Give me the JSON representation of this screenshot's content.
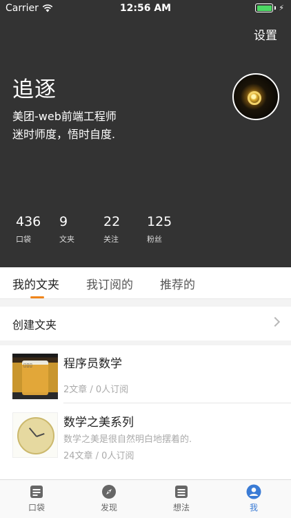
{
  "status_bar": {
    "carrier": "Carrier",
    "time": "12:56 AM",
    "battery_color": "#4cd964"
  },
  "header": {
    "settings_label": "设置",
    "name": "追逐",
    "job": "美团-web前端工程师",
    "motto": "迷时师度，悟时自度.",
    "background_color": "#333333"
  },
  "stats": [
    {
      "value": "436",
      "label": "口袋"
    },
    {
      "value": "9",
      "label": "文夹"
    },
    {
      "value": "22",
      "label": "关注"
    },
    {
      "value": "125",
      "label": "粉丝"
    }
  ],
  "tabs": [
    {
      "label": "我的文夹",
      "active": true
    },
    {
      "label": "我订阅的",
      "active": false
    },
    {
      "label": "推荐的",
      "active": false
    }
  ],
  "accent_color": "#f0851b",
  "create_folder_label": "创建文夹",
  "folders": [
    {
      "title": "程序员数学",
      "description": "",
      "meta": "2文章 / 0人订阅",
      "thumb_icon": "beer-photo"
    },
    {
      "title": "数学之美系列",
      "description": "数学之美是很自然明白地摆着的.",
      "meta": "24文章 / 0人订阅",
      "thumb_icon": "clock-photo"
    }
  ],
  "tabbar": [
    {
      "label": "口袋",
      "icon": "document-icon",
      "active": false
    },
    {
      "label": "发现",
      "icon": "compass-icon",
      "active": false
    },
    {
      "label": "想法",
      "icon": "note-icon",
      "active": false
    },
    {
      "label": "我",
      "icon": "person-icon",
      "active": true
    }
  ],
  "tabbar_active_color": "#3a7bd5"
}
